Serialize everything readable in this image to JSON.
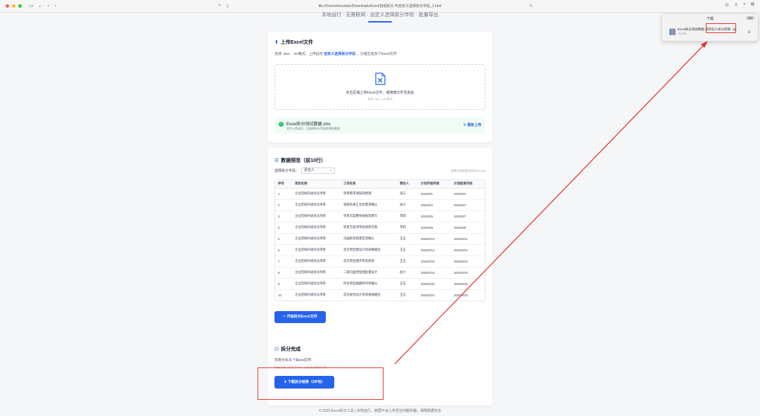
{
  "browser": {
    "url": "file:///Users/mountain/Downloads/Excel自动拆分-可自定义选择拆分字段_1.html",
    "lock_icon": "document-icon"
  },
  "header": {
    "subtitle": "本地运行 · 无需联网 · 自定义选择拆分字段 · 批量导出"
  },
  "upload": {
    "title": "上传Excel文件",
    "desc_prefix": "支持 .xlsx、.xls格式，上传后可",
    "desc_link": "自定义选择拆分字段",
    "desc_suffix": "，分组生成多个Excel文件",
    "drop_text": "点击区域上传Excel文件，或拖拽文件至此处",
    "drop_sub": "支持 .xlsx / .xls 格式",
    "file_name": "Excel拆分测试数据.xlsx",
    "file_status": "文件上传成功，可选择拆分字段并预览数据",
    "reupload_label": "重新上传"
  },
  "preview": {
    "title": "数据预览（前10行）",
    "select_label": "选择拆分字段：",
    "select_value": "责任人",
    "select_hint": "选择后将按该字段拆分Excel",
    "headers": [
      "序号",
      "项目名称",
      "工作任务",
      "责任人",
      "计划开始时间",
      "计划结束时间"
    ],
    "rows": [
      [
        "1",
        "企业官网升级优化项目",
        "项目需求调研及梳理",
        "张三",
        "2026/3/1",
        "2026/3/3"
      ],
      [
        "2",
        "企业官网升级优化项目",
        "调研结果汇总及需求确认",
        "张三",
        "2026/3/4",
        "2026/3/4"
      ],
      [
        "3",
        "企业官网升级优化项目",
        "项目方案整体规划及撰写",
        "李四",
        "2026/3/5",
        "2026/3/7"
      ],
      [
        "4",
        "企业官网升级优化项目",
        "项目方案评审及修改完善",
        "李四",
        "2026/3/8",
        "2026/3/9"
      ],
      [
        "5",
        "企业官网升级优化项目",
        "页面框架搭建定及确认",
        "王五",
        "2026/3/10",
        "2026/3/11"
      ],
      [
        "6",
        "企业官网升级优化项目",
        "首页原型图设计及初稿输出",
        "王五",
        "2026/3/12",
        "2026/3/14"
      ],
      [
        "7",
        "企业官网升级优化项目",
        "首页原型图评审及修改",
        "王五",
        "2026/3/15",
        "2026/3/15"
      ],
      [
        "8",
        "企业官网升级优化项目",
        "二级页面原型图批量设计",
        "赵六",
        "2026/3/16",
        "2026/3/19"
      ],
      [
        "9",
        "企业官网升级优化项目",
        "所有原型图最终评审确认",
        "王五",
        "2026/3/20",
        "2026/3/20"
      ],
      [
        "10",
        "企业官网升级优化项目",
        "首页视觉设计及效果图输出",
        "王五",
        "2026/3/21",
        "2026/3/23"
      ]
    ],
    "split_button": "开始拆分Excel文件"
  },
  "done": {
    "title": "拆分完成",
    "count_prefix": "共拆分出",
    "count_value": "5",
    "count_suffix": "个Excel文件",
    "sub": "所有文件已打包为ZIP，点击下方按钮下载",
    "download_button": "下载拆分结果（ZIP包）"
  },
  "footer": {
    "text": "© 2025 Excel拆分工具 | 本地运行，数据不会上传至任何服务器，保障数据安全"
  },
  "downloads_popup": {
    "title": "下载",
    "clear_label": "清除",
    "item_name_a": "Excel拆分测试数据",
    "item_name_b": "按责任人拆分结果",
    "item_name_c": ".zip",
    "item_size": "10.8 KB"
  },
  "colors": {
    "accent": "#2563eb",
    "annotation": "#e53935",
    "success": "#22c55e"
  }
}
